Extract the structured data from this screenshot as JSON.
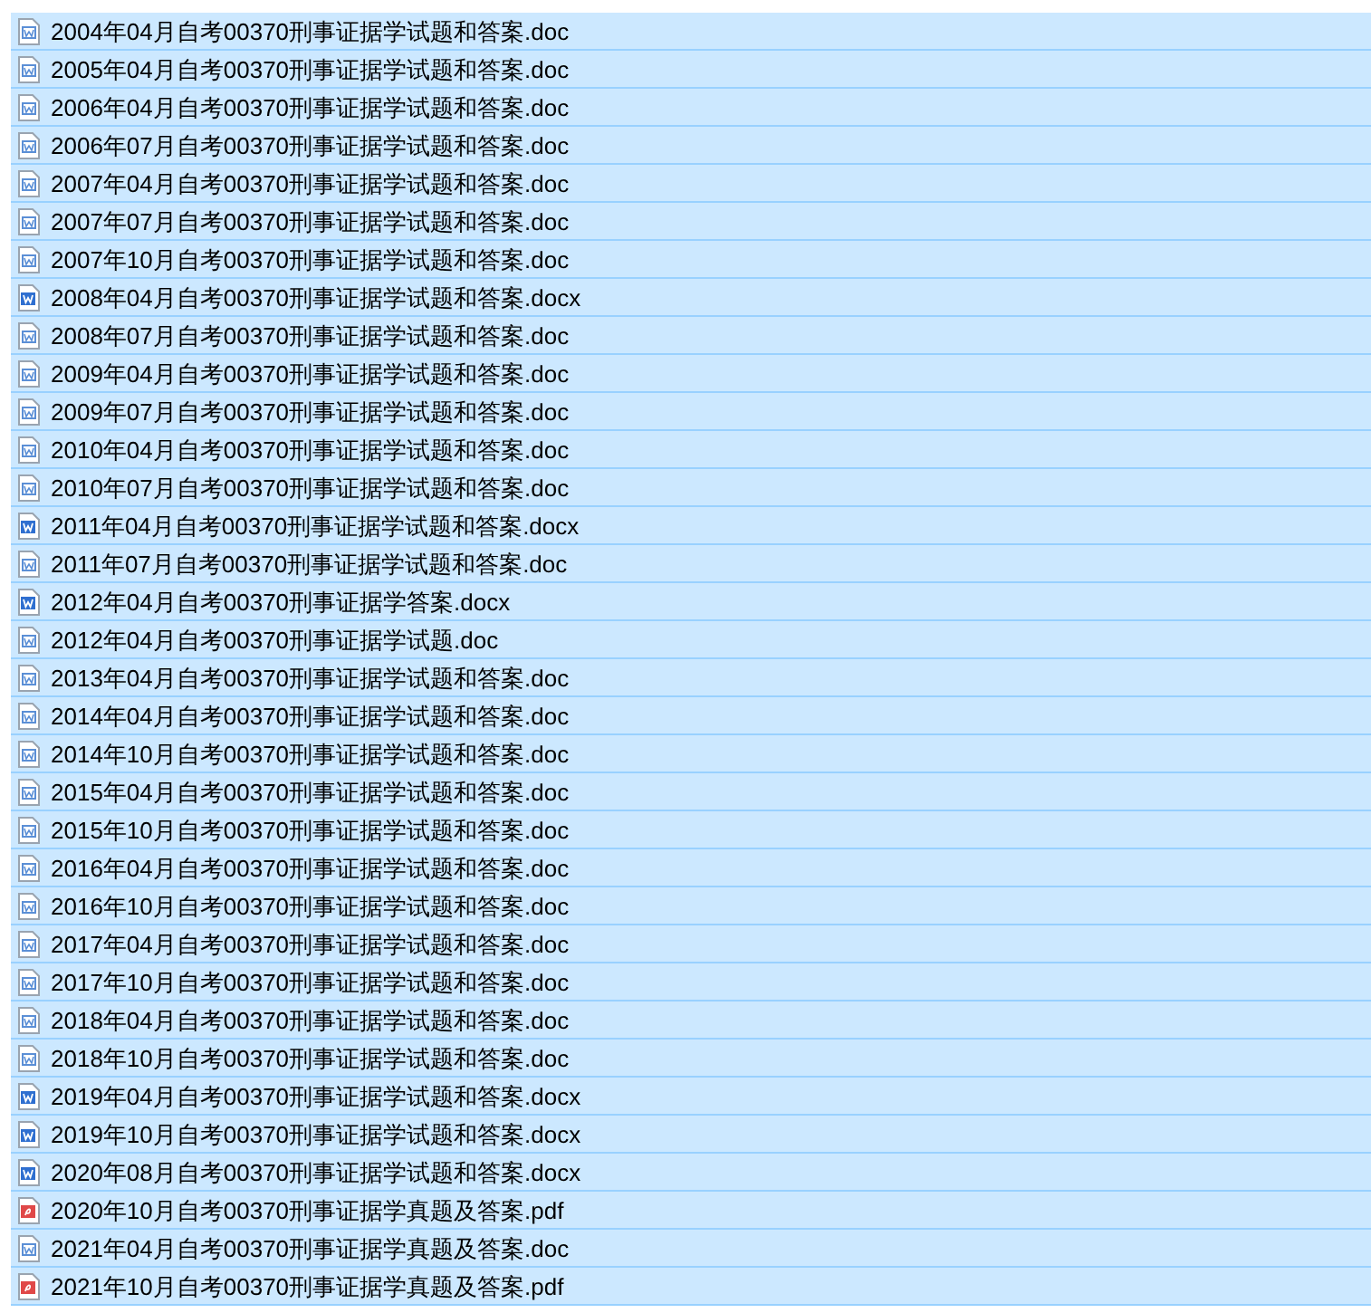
{
  "files": [
    {
      "name": "2004年04月自考00370刑事证据学试题和答案.doc",
      "kind": "doc",
      "selected": true
    },
    {
      "name": "2005年04月自考00370刑事证据学试题和答案.doc",
      "kind": "doc",
      "selected": true
    },
    {
      "name": "2006年04月自考00370刑事证据学试题和答案.doc",
      "kind": "doc",
      "selected": true
    },
    {
      "name": "2006年07月自考00370刑事证据学试题和答案.doc",
      "kind": "doc",
      "selected": true
    },
    {
      "name": "2007年04月自考00370刑事证据学试题和答案.doc",
      "kind": "doc",
      "selected": true
    },
    {
      "name": "2007年07月自考00370刑事证据学试题和答案.doc",
      "kind": "doc",
      "selected": true
    },
    {
      "name": "2007年10月自考00370刑事证据学试题和答案.doc",
      "kind": "doc",
      "selected": true
    },
    {
      "name": "2008年04月自考00370刑事证据学试题和答案.docx",
      "kind": "docx",
      "selected": true
    },
    {
      "name": "2008年07月自考00370刑事证据学试题和答案.doc",
      "kind": "doc",
      "selected": true
    },
    {
      "name": "2009年04月自考00370刑事证据学试题和答案.doc",
      "kind": "doc",
      "selected": true
    },
    {
      "name": "2009年07月自考00370刑事证据学试题和答案.doc",
      "kind": "doc",
      "selected": true
    },
    {
      "name": "2010年04月自考00370刑事证据学试题和答案.doc",
      "kind": "doc",
      "selected": true
    },
    {
      "name": "2010年07月自考00370刑事证据学试题和答案.doc",
      "kind": "doc",
      "selected": true
    },
    {
      "name": "2011年04月自考00370刑事证据学试题和答案.docx",
      "kind": "docx",
      "selected": true
    },
    {
      "name": "2011年07月自考00370刑事证据学试题和答案.doc",
      "kind": "doc",
      "selected": true
    },
    {
      "name": "2012年04月自考00370刑事证据学答案.docx",
      "kind": "docx",
      "selected": true
    },
    {
      "name": "2012年04月自考00370刑事证据学试题.doc",
      "kind": "doc",
      "selected": true
    },
    {
      "name": "2013年04月自考00370刑事证据学试题和答案.doc",
      "kind": "doc",
      "selected": true
    },
    {
      "name": "2014年04月自考00370刑事证据学试题和答案.doc",
      "kind": "doc",
      "selected": true
    },
    {
      "name": "2014年10月自考00370刑事证据学试题和答案.doc",
      "kind": "doc",
      "selected": true
    },
    {
      "name": "2015年04月自考00370刑事证据学试题和答案.doc",
      "kind": "doc",
      "selected": true
    },
    {
      "name": "2015年10月自考00370刑事证据学试题和答案.doc",
      "kind": "doc",
      "selected": true
    },
    {
      "name": "2016年04月自考00370刑事证据学试题和答案.doc",
      "kind": "doc",
      "selected": true
    },
    {
      "name": "2016年10月自考00370刑事证据学试题和答案.doc",
      "kind": "doc",
      "selected": true
    },
    {
      "name": "2017年04月自考00370刑事证据学试题和答案.doc",
      "kind": "doc",
      "selected": true
    },
    {
      "name": "2017年10月自考00370刑事证据学试题和答案.doc",
      "kind": "doc",
      "selected": true
    },
    {
      "name": "2018年04月自考00370刑事证据学试题和答案.doc",
      "kind": "doc",
      "selected": true
    },
    {
      "name": "2018年10月自考00370刑事证据学试题和答案.doc",
      "kind": "doc",
      "selected": true
    },
    {
      "name": "2019年04月自考00370刑事证据学试题和答案.docx",
      "kind": "docx",
      "selected": true
    },
    {
      "name": "2019年10月自考00370刑事证据学试题和答案.docx",
      "kind": "docx",
      "selected": true
    },
    {
      "name": "2020年08月自考00370刑事证据学试题和答案.docx",
      "kind": "docx",
      "selected": true
    },
    {
      "name": "2020年10月自考00370刑事证据学真题及答案.pdf",
      "kind": "pdf",
      "selected": true
    },
    {
      "name": "2021年04月自考00370刑事证据学真题及答案.doc",
      "kind": "doc",
      "selected": true
    },
    {
      "name": "2021年10月自考00370刑事证据学真题及答案.pdf",
      "kind": "pdf",
      "selected": true
    }
  ]
}
